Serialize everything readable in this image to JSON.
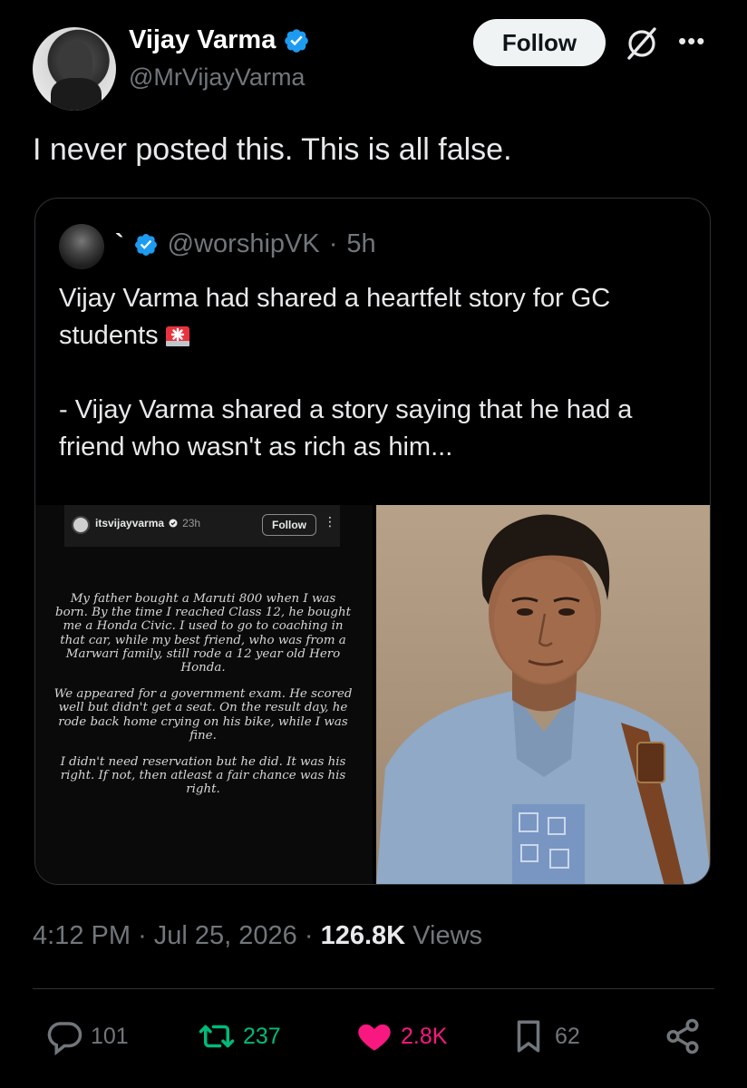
{
  "author": {
    "name": "Vijay Varma",
    "handle": "@MrVijayVarma",
    "follow_label": "Follow",
    "verified": true
  },
  "tweet": {
    "text": "I never posted this. This is all false."
  },
  "quoted": {
    "name": "`",
    "handle": "@worshipVK",
    "separator": "·",
    "time": "5h",
    "text_line1": "Vijay Varma had shared a heartfelt story for GC students",
    "text_line2": "- Vijay Varma shared a story saying that he had a friend who wasn't as rich as him...",
    "media_left": {
      "username": "itsvijayvarma",
      "time": "23h",
      "follow_label": "Follow",
      "paragraph1": "My father bought a Maruti 800 when I was born. By the time I reached Class 12, he bought me a Honda Civic. I used to go to coaching in that car, while my best friend, who was from a Marwari family, still rode a 12 year old Hero Honda.",
      "paragraph2": "We appeared for a government exam. He scored well but didn't get a seat. On the result day, he rode back home crying on his bike, while I was fine.",
      "paragraph3": "I didn't need reservation but he did. It was his right. If not, then atleast a fair chance was his right."
    }
  },
  "meta": {
    "time": "4:12 PM",
    "date": "Jul 25, 2026",
    "dot": "·",
    "views_count": "126.8K",
    "views_label": "Views"
  },
  "actions": {
    "replies": "101",
    "reposts": "237",
    "likes": "2.8K",
    "bookmarks": "62"
  },
  "colors": {
    "background": "#000000",
    "verified": "#1d9bf0",
    "repost": "#00ba7c",
    "like": "#f91880",
    "muted": "#71767b"
  }
}
